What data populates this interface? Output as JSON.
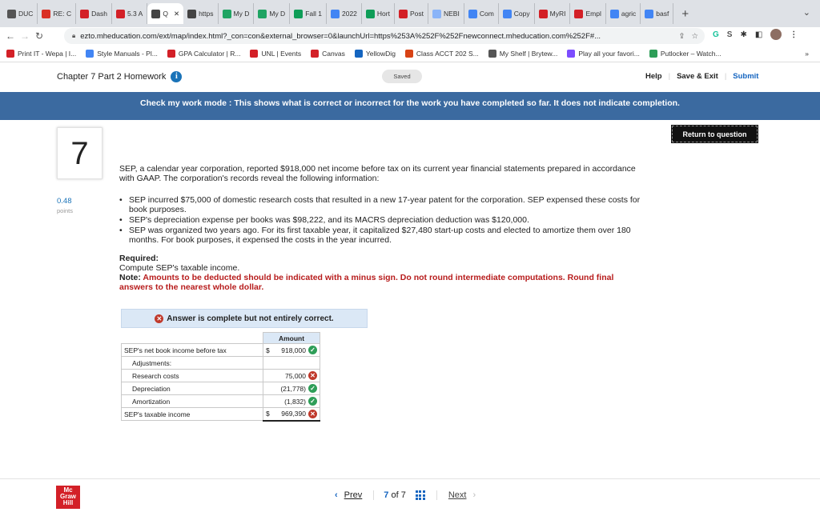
{
  "browser": {
    "tabs": [
      {
        "label": "DUC",
        "icon": "circle-icon",
        "color": "#555555"
      },
      {
        "label": "RE: C",
        "icon": "gmail-icon",
        "color": "#d93025"
      },
      {
        "label": "Dash",
        "icon": "n-icon",
        "color": "#d32027"
      },
      {
        "label": "5.3 A",
        "icon": "n-icon",
        "color": "#d32027"
      },
      {
        "label": "Q",
        "icon": "globe-icon",
        "color": "#444444",
        "active": true
      },
      {
        "label": "https",
        "icon": "globe-icon",
        "color": "#444444"
      },
      {
        "label": "My D",
        "icon": "drive-icon",
        "color": "#1fa463"
      },
      {
        "label": "My D",
        "icon": "drive-icon",
        "color": "#1fa463"
      },
      {
        "label": "Fall 1",
        "icon": "plus-doc-icon",
        "color": "#0f9d58"
      },
      {
        "label": "2022",
        "icon": "doc-icon",
        "color": "#4285f4"
      },
      {
        "label": "Hort",
        "icon": "plus-doc-icon",
        "color": "#0f9d58"
      },
      {
        "label": "Post",
        "icon": "h-icon",
        "color": "#d32027"
      },
      {
        "label": "NEBI",
        "icon": "v-icon",
        "color": "#8ab4f8"
      },
      {
        "label": "Com",
        "icon": "doc-icon",
        "color": "#4285f4"
      },
      {
        "label": "Copy",
        "icon": "doc-icon",
        "color": "#4285f4"
      },
      {
        "label": "MyRI",
        "icon": "n-icon",
        "color": "#d32027"
      },
      {
        "label": "Empl",
        "icon": "n-icon",
        "color": "#d32027"
      },
      {
        "label": "agric",
        "icon": "google-icon",
        "color": "#4285f4"
      },
      {
        "label": "basf",
        "icon": "google-icon",
        "color": "#4285f4"
      }
    ],
    "new_tab": "+",
    "url": "ezto.mheducation.com/ext/map/index.html?_con=con&external_browser=0&launchUrl=https%253A%252F%252Fnewconnect.mheducation.com%252F#...",
    "bookmarks": [
      {
        "label": "Print IT - Wepa | I...",
        "icon": "n-icon",
        "color": "#d32027"
      },
      {
        "label": "Style Manuals - Pl...",
        "icon": "cloud-icon",
        "color": "#4285f4"
      },
      {
        "label": "GPA Calculator | R...",
        "icon": "n-icon",
        "color": "#d32027"
      },
      {
        "label": "UNL | Events",
        "icon": "n-icon",
        "color": "#d32027"
      },
      {
        "label": "Canvas",
        "icon": "n-icon",
        "color": "#d32027"
      },
      {
        "label": "YellowDig",
        "icon": "pin-icon",
        "color": "#1565c0"
      },
      {
        "label": "Class ACCT 202 S...",
        "icon": "calendar-icon",
        "color": "#d84315"
      },
      {
        "label": "My Shelf | Brytew...",
        "icon": "book-icon",
        "color": "#555555"
      },
      {
        "label": "Play all your favori...",
        "icon": "game-icon",
        "color": "#7c4dff"
      },
      {
        "label": "Putlocker – Watch...",
        "icon": "play-icon",
        "color": "#2e9e58"
      }
    ],
    "bookmarks_more": "»"
  },
  "app": {
    "chapter_title": "Chapter 7 Part 2 Homework",
    "saved": "Saved",
    "help": "Help",
    "save_exit": "Save & Exit",
    "submit": "Submit",
    "banner": "Check my work mode : This shows what is correct or incorrect for the work you have completed so far. It does not indicate completion.",
    "return_button": "Return to question"
  },
  "question": {
    "number": "7",
    "points_value": "0.48",
    "points_label": "points",
    "intro": "SEP, a calendar year corporation, reported $918,000 net income before tax on its current year financial statements prepared in accordance with GAAP. The corporation's records reveal the following information:",
    "bullets": [
      "SEP incurred $75,000 of domestic research costs that resulted in a new 17-year patent for the corporation. SEP expensed these costs for book purposes.",
      "SEP's depreciation expense per books was $98,222, and its MACRS depreciation deduction was $120,000.",
      "SEP was organized two years ago. For its first taxable year, it capitalized $27,480 start-up costs and elected to amortize them over 180 months. For book purposes, it expensed the costs in the year incurred."
    ],
    "required_label": "Required:",
    "required_text": "Compute SEP's taxable income.",
    "note_label": "Note:",
    "note_text": "Amounts to be deducted should be indicated with a minus sign. Do not round intermediate computations. Round final answers to the nearest whole dollar."
  },
  "answer": {
    "status": "Answer is complete but not entirely correct.",
    "column_header": "Amount",
    "rows": [
      {
        "label": "SEP's net book income before tax",
        "currency": "$",
        "value": "918,000",
        "status": "correct"
      },
      {
        "label": "Adjustments:",
        "currency": "",
        "value": "",
        "status": ""
      },
      {
        "label": "Research costs",
        "currency": "",
        "value": "75,000",
        "status": "incorrect"
      },
      {
        "label": "Depreciation",
        "currency": "",
        "value": "(21,778)",
        "status": "correct"
      },
      {
        "label": "Amortization",
        "currency": "",
        "value": "(1,832)",
        "status": "correct"
      },
      {
        "label": "SEP's taxable income",
        "currency": "$",
        "value": "969,390",
        "status": "incorrect"
      }
    ]
  },
  "pager": {
    "prev": "Prev",
    "current": "7",
    "of": "of",
    "total": "7",
    "next": "Next"
  },
  "footer": {
    "logo_lines": [
      "Mc",
      "Graw",
      "Hill"
    ]
  }
}
